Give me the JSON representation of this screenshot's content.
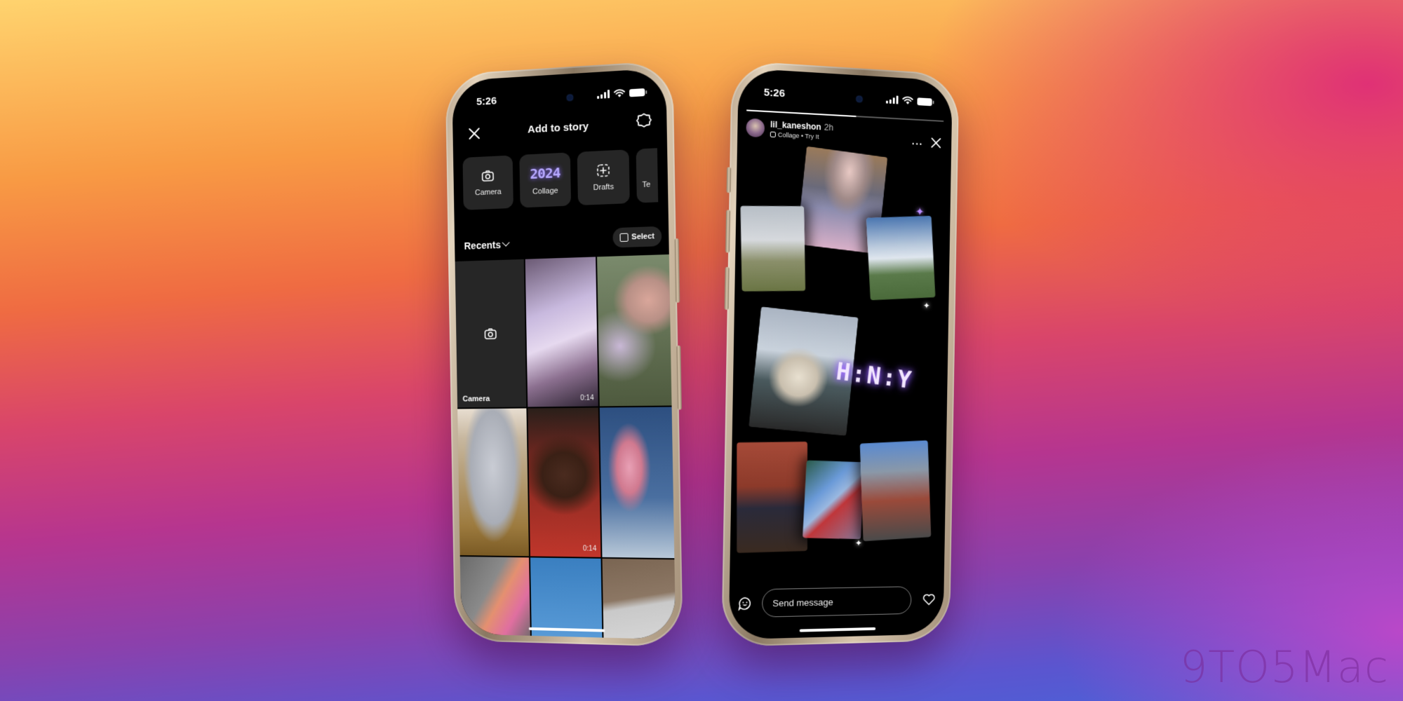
{
  "background": {
    "gradient_colors": [
      "#ffd36e",
      "#f89a44",
      "#ef6b42",
      "#d9456a",
      "#b6358f",
      "#8a41ad",
      "#5b55cf"
    ],
    "watermark": "9TO5Mac"
  },
  "left_phone": {
    "status_bar": {
      "time": "5:26",
      "icons": [
        "signal-icon",
        "wifi-icon",
        "battery-icon"
      ]
    },
    "header": {
      "title": "Add to story",
      "close_icon": "close-icon",
      "settings_icon": "gear-icon"
    },
    "tiles": [
      {
        "label": "Camera",
        "icon": "camera-icon"
      },
      {
        "label": "Collage",
        "icon": "collage-2024-icon",
        "badge_text": "2024"
      },
      {
        "label": "Drafts",
        "icon": "drafts-icon"
      },
      {
        "label": "Te",
        "icon": ""
      }
    ],
    "recents": {
      "label": "Recents",
      "select_label": "Select"
    },
    "grid": [
      {
        "type": "camera",
        "label": "Camera"
      },
      {
        "type": "video",
        "duration": "0:14"
      },
      {
        "type": "photo"
      },
      {
        "type": "photo"
      },
      {
        "type": "video",
        "duration": "0:14"
      },
      {
        "type": "photo"
      },
      {
        "type": "photo"
      },
      {
        "type": "photo"
      },
      {
        "type": "photo"
      }
    ]
  },
  "right_phone": {
    "status_bar": {
      "time": "5:26",
      "icons": [
        "signal-icon",
        "wifi-icon",
        "battery-icon"
      ]
    },
    "story": {
      "progress": 0.55,
      "username": "lil_kaneshon",
      "age": "2h",
      "subtitle": "Collage • Try It",
      "more_label": "···",
      "sticker_text": "H:N:Y"
    },
    "composer": {
      "placeholder": "Send message"
    }
  }
}
